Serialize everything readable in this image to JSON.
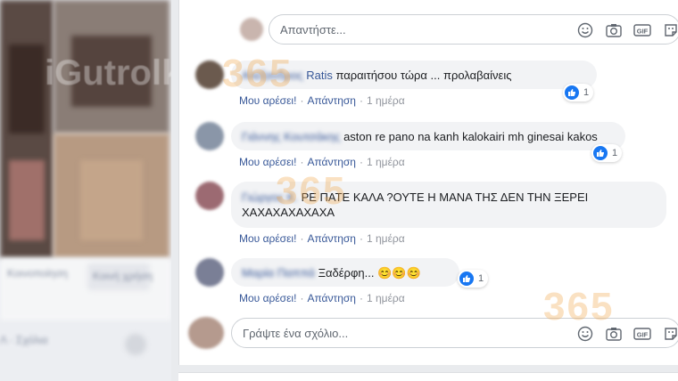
{
  "reply_box": {
    "placeholder": "Απαντήστε..."
  },
  "new_comment_box": {
    "placeholder": "Γράψτε ένα σχόλιο..."
  },
  "tool_icons": [
    "emoji-icon",
    "camera-icon",
    "gif-icon",
    "sticker-icon"
  ],
  "comments": [
    {
      "author": "Αλέξανδρος",
      "author_suffix": "Ratis",
      "text": "παραιτήσου τώρα ... προλαβαίνεις",
      "like_label": "Μου αρέσει!",
      "reply_label": "Απάντηση",
      "time": "1 ημέρα",
      "reactions": "1"
    },
    {
      "author": "Γιάννης Κουτσάκης",
      "text": "aston re pano na kanh kalokairi mh ginesai kakos",
      "like_label": "Μου αρέσει!",
      "reply_label": "Απάντηση",
      "time": "1 ημέρα",
      "reactions": "1"
    },
    {
      "author": "Γιώργος Κ.",
      "text_line1": "ΡΕ ΠΑΤΕ ΚΑΛΑ ?ΟΥΤΕ Η ΜΑΝΑ ΤΗΣ ΔΕΝ ΤΗΝ ΞΕΡΕΙ",
      "text_line2": "ΧΑΧΑΧΑΧΑΧΑΧΑ",
      "like_label": "Μου αρέσει!",
      "reply_label": "Απάντηση",
      "time": "1 ημέρα"
    },
    {
      "author": "Μαρία Παππά",
      "text": "Ξαδέρφη...",
      "emojis": "😊😊😊",
      "like_label": "Μου αρέσει!",
      "reply_label": "Απάντηση",
      "time": "1 ημέρα",
      "reactions": "1"
    }
  ],
  "watermark": {
    "brand": "iGutrolki",
    "number": "365"
  },
  "left_pane": {
    "snippet_1": "Κοινοποίηση",
    "snippet_2": "Κοινή χρήση",
    "snippet_3": "Λ · Σχόλια"
  },
  "colors": {
    "link": "#385898",
    "like_blue": "#1877f2",
    "bubble": "#f2f3f5"
  }
}
